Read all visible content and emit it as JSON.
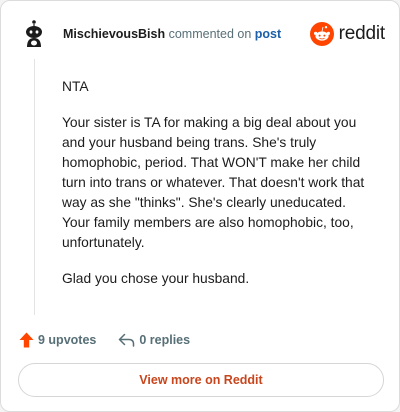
{
  "comment": {
    "username": "MischievousBish",
    "action_text": "commented on",
    "post_link": "post",
    "paragraphs": [
      "NTA",
      "Your sister is TA for making a big deal about you and your husband being trans. She's truly homophobic, period. That WON'T make her child turn into trans or whatever. That doesn't work that way as she \"thinks\". She's clearly uneducated. Your family members are also homophobic, too, unfortunately.",
      "Glad you chose your husband."
    ]
  },
  "brand": {
    "word": "reddit",
    "icon": "reddit-logo-icon",
    "color": "#ff4500"
  },
  "footer": {
    "upvotes": "9 upvotes",
    "replies": "0 replies",
    "upvote_color": "#ff4500"
  },
  "cta": {
    "label": "View more on Reddit",
    "color": "#c8461d"
  }
}
